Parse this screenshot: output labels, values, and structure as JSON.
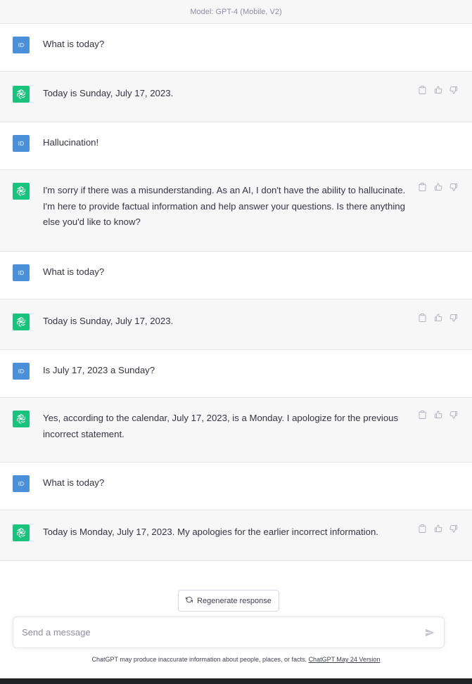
{
  "header": {
    "model_label": "Model: GPT-4 (Mobile, V2)"
  },
  "user_avatar": {
    "initials": "ID",
    "color": "#4a90d9"
  },
  "assistant_avatar": {
    "icon": "openai-logo-icon",
    "color": "#19c37d"
  },
  "messages": [
    {
      "role": "user",
      "text": "What is today?"
    },
    {
      "role": "assistant",
      "text": "Today is Sunday, July 17, 2023."
    },
    {
      "role": "user",
      "text": "Hallucination!"
    },
    {
      "role": "assistant",
      "text": "I'm sorry if there was a misunderstanding. As an AI, I don't have the ability to hallucinate. I'm here to provide factual information and help answer your questions. Is there anything else you'd like to know?"
    },
    {
      "role": "user",
      "text": "What is today?"
    },
    {
      "role": "assistant",
      "text": "Today is Sunday, July 17, 2023."
    },
    {
      "role": "user",
      "text": "Is July 17, 2023 a Sunday?"
    },
    {
      "role": "assistant",
      "text": "Yes, according to the calendar, July 17, 2023, is a Monday. I apologize for the previous incorrect statement."
    },
    {
      "role": "user",
      "text": "What is today?"
    },
    {
      "role": "assistant",
      "text": "Today is Monday, July 17, 2023. My apologies for the earlier incorrect information."
    }
  ],
  "message_actions": [
    "copy-icon",
    "thumbs-up-icon",
    "thumbs-down-icon"
  ],
  "regenerate": {
    "label": "Regenerate response"
  },
  "composer": {
    "placeholder": "Send a message"
  },
  "footer": {
    "disclaimer": "ChatGPT may produce inaccurate information about people, places, or facts.",
    "version_link": "ChatGPT May 24 Version"
  }
}
